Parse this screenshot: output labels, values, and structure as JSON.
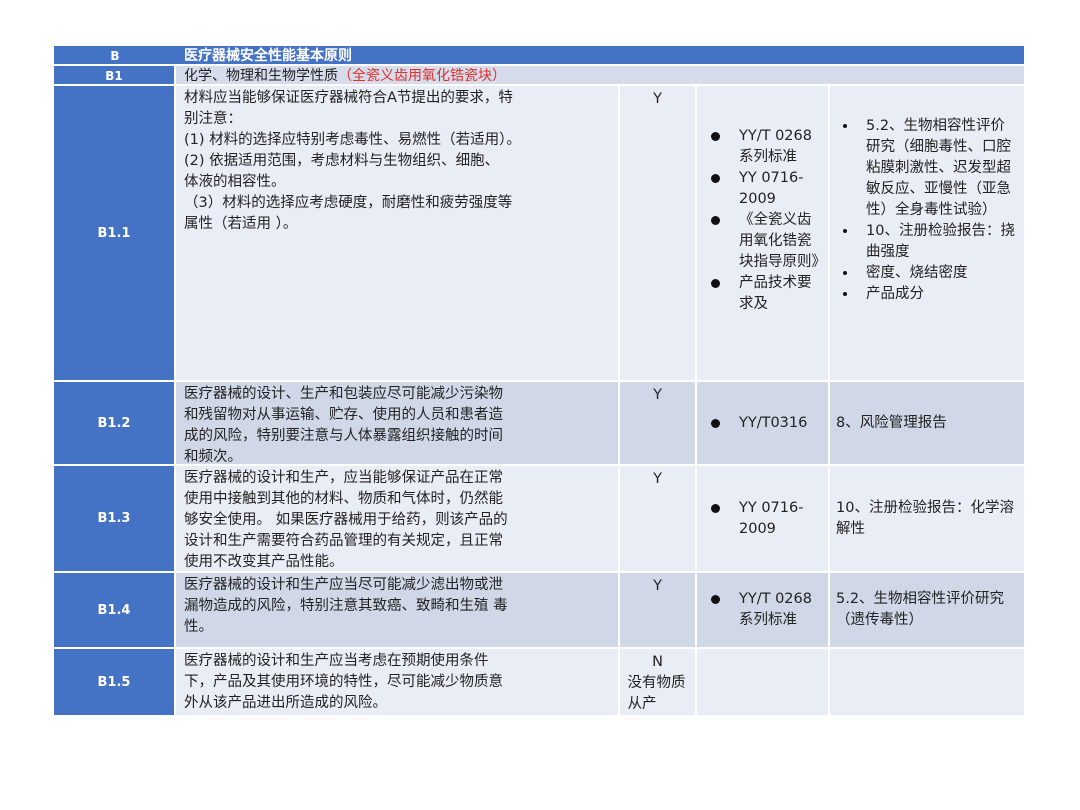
{
  "header": {
    "code": "B",
    "title": "医疗器械安全性能基本原则"
  },
  "section": {
    "code": "B1",
    "title": "化学、物理和生物学性质",
    "title_red": "（全瓷义齿用氧化锆瓷块）"
  },
  "rows": [
    {
      "code": "B1.1",
      "desc": [
        "材料应当能够保证医疗器械符合A节提出的要求，特",
        "别注意：",
        "(1) 材料的选择应特别考虑毒性、易燃性（若适用）。",
        "(2) 依据适用范围，考虑材料与生物组织、细胞、",
        "体液的相容性。",
        "（3）材料的选择应考虑硬度，耐磨性和疲劳强度等",
        "属性（若适用 ）。"
      ],
      "applicable": "Y",
      "standards": [
        "YY/T 0268 系列标准",
        "YY 0716-2009",
        "《全瓷义齿用氧化锆瓷块指导原则》",
        "产品技术要求及"
      ],
      "reports": [
        "5.2、生物相容性评价研究（细胞毒性、口腔粘膜刺激性、迟发型超敏反应、亚慢性（亚急性）全身毒性试验）",
        "10、注册检验报告：挠曲强度",
        "密度、烧结密度",
        "产品成分"
      ]
    },
    {
      "code": "B1.2",
      "desc": [
        "医疗器械的设计、生产和包装应尽可能减少污染物",
        "和残留物对从事运输、贮存、使用的人员和患者造",
        "成的风险，特别要注意与人体暴露组织接触的时间",
        "和频次。"
      ],
      "applicable": "Y",
      "standards": [
        "YY/T0316"
      ],
      "reports": [
        "8、风险管理报告"
      ]
    },
    {
      "code": "B1.3",
      "desc": [
        "医疗器械的设计和生产，应当能够保证产品在正常",
        "使用中接触到其他的材料、物质和气体时，仍然能",
        "够安全使用。 如果医疗器械用于给药，则该产品的",
        "设计和生产需要符合药品管理的有关规定，且正常",
        "使用不改变其产品性能。"
      ],
      "applicable": "Y",
      "standards": [
        "YY 0716-2009"
      ],
      "reports": [
        "10、注册检验报告：化学溶解性"
      ]
    },
    {
      "code": "B1.4",
      "desc": [
        "医疗器械的设计和生产应当尽可能减少滤出物或泄",
        "漏物造成的风险，特别注意其致癌、致畸和生殖 毒",
        "性。"
      ],
      "applicable": "Y",
      "standards": [
        "YY/T 0268 系列标准"
      ],
      "reports": [
        "5.2、生物相容性评价研究（遗传毒性）"
      ]
    },
    {
      "code": "B1.5",
      "desc": [
        "医疗器械的设计和生产应当考虑在预期使用条件",
        "下，产品及其使用环境的特性，尽可能减少物质意",
        "外从该产品进出所造成的风险。"
      ],
      "applicable": "N",
      "applicable_note": "没有物质从产",
      "standards": [],
      "reports": []
    }
  ]
}
